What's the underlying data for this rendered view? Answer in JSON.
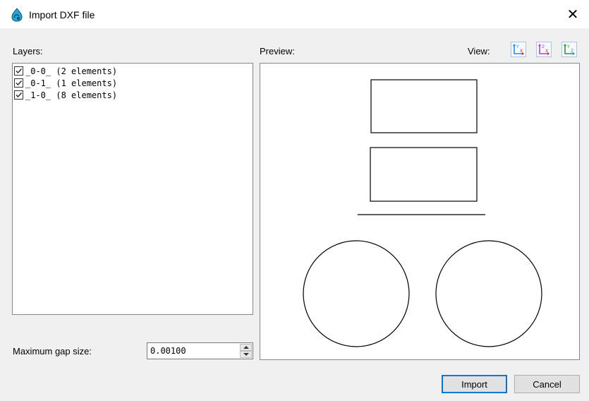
{
  "window": {
    "title": "Import DXF file",
    "close_label": "✕"
  },
  "layers": {
    "label": "Layers:",
    "items": [
      {
        "label": "_0-0_ (2 elements)",
        "checked": true
      },
      {
        "label": "_0-1_ (1 elements)",
        "checked": true
      },
      {
        "label": "_1-0_ (8 elements)",
        "checked": true
      }
    ]
  },
  "preview": {
    "label": "Preview:"
  },
  "view": {
    "label": "View:",
    "buttons": [
      "view-xy-icon",
      "view-xz-icon",
      "view-yz-icon"
    ]
  },
  "gap": {
    "label": "Maximum gap size:",
    "value": "0.00100"
  },
  "buttons": {
    "import": "Import",
    "cancel": "Cancel"
  },
  "colors": {
    "accent": "#0078d7",
    "icon_blue": "#1e90ff"
  }
}
